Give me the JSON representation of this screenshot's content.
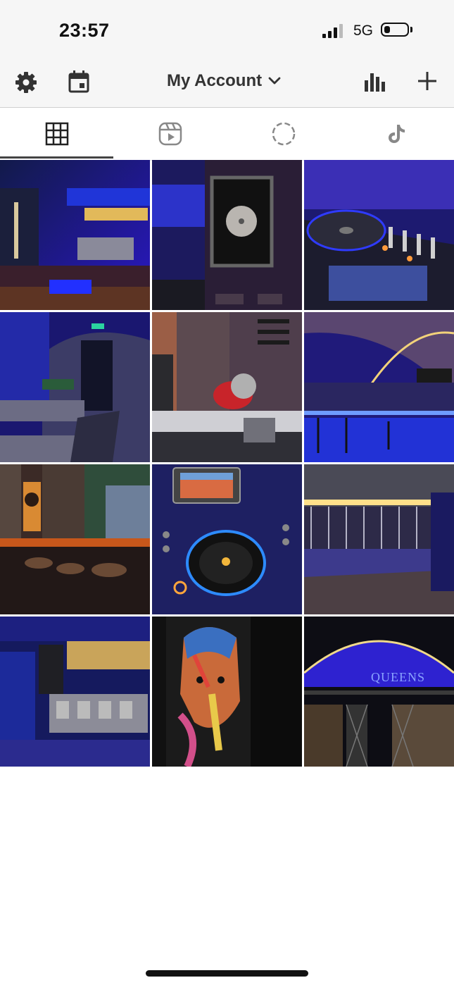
{
  "status": {
    "time": "23:57",
    "network": "5G",
    "battery_level": 0.2
  },
  "header": {
    "title": "My Account",
    "left_icons": [
      "gear-icon",
      "calendar-icon"
    ],
    "right_icons": [
      "bar-chart-icon",
      "plus-icon"
    ]
  },
  "tabs": [
    {
      "icon": "grid-icon",
      "selected": true
    },
    {
      "icon": "reels-icon",
      "selected": false
    },
    {
      "icon": "stories-icon",
      "selected": false
    },
    {
      "icon": "tiktok-icon",
      "selected": false
    }
  ],
  "grid": {
    "photos": [
      {
        "name": "bar-counter-blue-lights"
      },
      {
        "name": "framed-record-wall"
      },
      {
        "name": "dj-mixer-closeup"
      },
      {
        "name": "lounge-seating-brick-arch"
      },
      {
        "name": "kitchen-slicer"
      },
      {
        "name": "vaulted-dance-floor"
      },
      {
        "name": "bar-stools-window"
      },
      {
        "name": "dj-turntable"
      },
      {
        "name": "glass-rack-bar"
      },
      {
        "name": "espresso-machine-bar"
      },
      {
        "name": "colorful-portrait-mural"
      },
      {
        "name": "arched-entrance-night"
      }
    ],
    "storefront_sign": "QUEENS"
  },
  "colors": {
    "accent": "#2d1ad6",
    "background": "#ffffff",
    "topbar": "#f6f6f6"
  }
}
